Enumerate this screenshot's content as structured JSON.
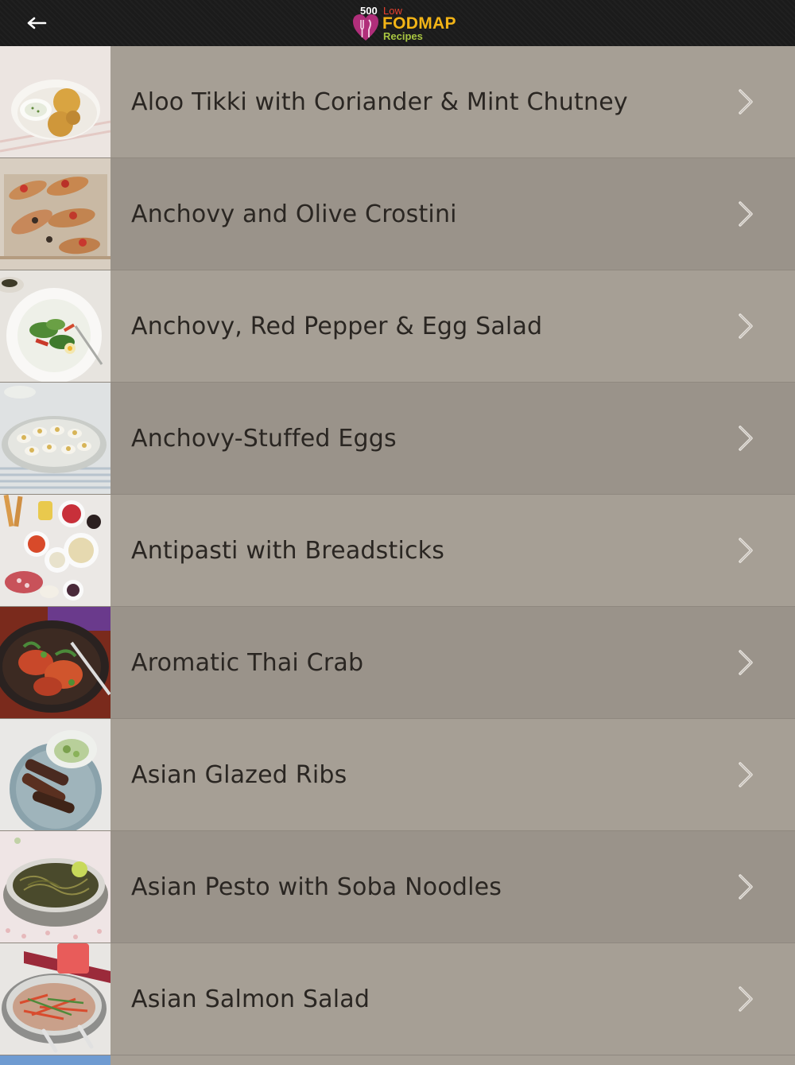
{
  "header": {
    "logo": {
      "line1": "500",
      "line2": "Low",
      "line3": "FODMAP",
      "line4": "Recipes"
    }
  },
  "recipes": [
    {
      "title": "Aloo Tikki with Coriander & Mint Chutney",
      "thumb": "tikki"
    },
    {
      "title": "Anchovy and Olive Crostini",
      "thumb": "crostini"
    },
    {
      "title": "Anchovy, Red Pepper & Egg Salad",
      "thumb": "salad"
    },
    {
      "title": "Anchovy-Stuffed Eggs",
      "thumb": "eggs"
    },
    {
      "title": "Antipasti with Breadsticks",
      "thumb": "antipasti"
    },
    {
      "title": "Aromatic Thai Crab",
      "thumb": "crab"
    },
    {
      "title": "Asian Glazed Ribs",
      "thumb": "ribs"
    },
    {
      "title": "Asian Pesto with Soba Noodles",
      "thumb": "noodles"
    },
    {
      "title": "Asian Salmon Salad",
      "thumb": "salmon"
    }
  ]
}
